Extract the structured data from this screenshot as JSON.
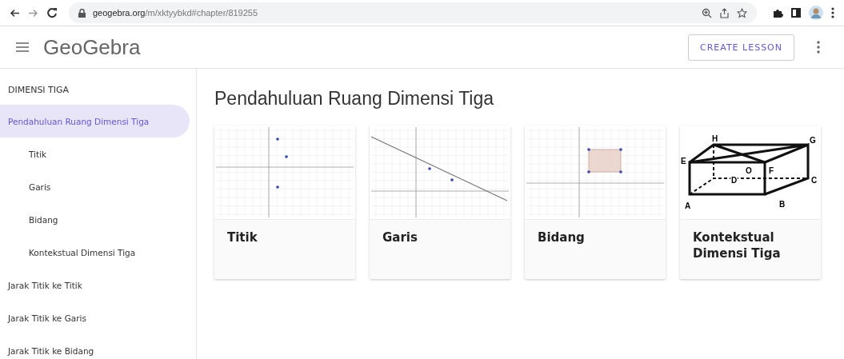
{
  "browser": {
    "url_host": "geogebra.org",
    "url_path": "/m/xktyybkd#chapter/819255"
  },
  "header": {
    "logo": "GeoGebra",
    "create_button": "CREATE LESSON"
  },
  "sidebar": {
    "section": "DIMENSI TIGA",
    "items": [
      {
        "label": "Pendahuluan Ruang Dimensi Tiga",
        "selected": true,
        "children": [
          {
            "label": "Titik",
            "selected": false
          },
          {
            "label": "Garis",
            "selected": false
          },
          {
            "label": "Bidang",
            "selected": false
          },
          {
            "label": "Kontekstual Dimensi Tiga",
            "selected": false
          }
        ]
      },
      {
        "label": "Jarak Titik ke Titik",
        "selected": false
      },
      {
        "label": "Jarak Titik ke Garis",
        "selected": false
      },
      {
        "label": "Jarak Titik ke Bidang",
        "selected": false
      }
    ]
  },
  "page_title": "Pendahuluan Ruang Dimensi Tiga",
  "cards": [
    {
      "title": "Titik",
      "kind": "points"
    },
    {
      "title": "Garis",
      "kind": "line"
    },
    {
      "title": "Bidang",
      "kind": "rectangle"
    },
    {
      "title": "Kontekstual Dimensi Tiga",
      "kind": "cuboid",
      "labels": [
        "H",
        "G",
        "E",
        "O",
        "F",
        "D",
        "C",
        "A",
        "B"
      ]
    }
  ]
}
